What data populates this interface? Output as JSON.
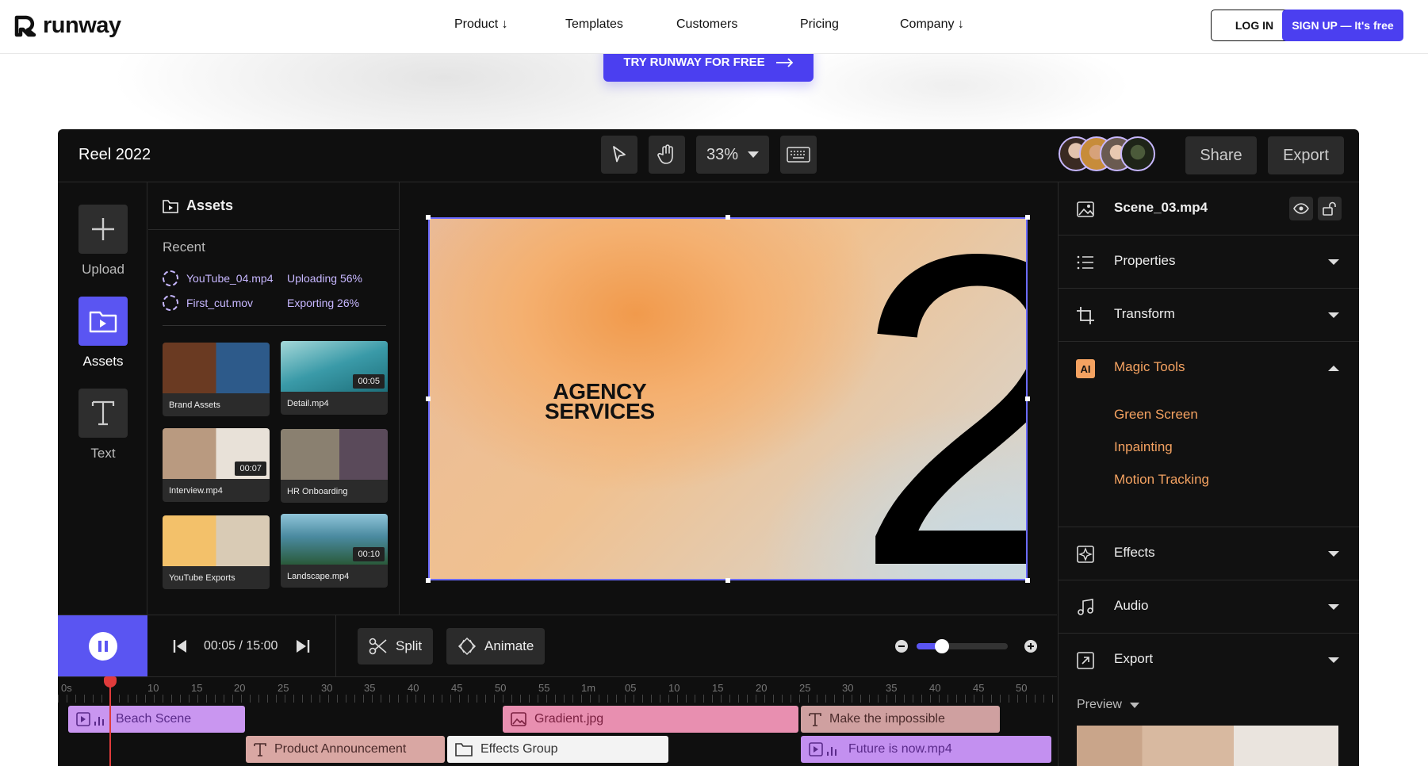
{
  "nav": {
    "brand": "runway",
    "links": [
      "Product ↓",
      "Templates",
      "Customers",
      "Pricing",
      "Company ↓"
    ],
    "login": "LOG IN",
    "signup": "SIGN UP — It's free"
  },
  "cta": {
    "label": "TRY RUNWAY FOR FREE"
  },
  "editor": {
    "project_title": "Reel 2022",
    "zoom": "33%",
    "share": "Share",
    "export": "Export",
    "rail": {
      "upload": "Upload",
      "assets": "Assets",
      "text": "Text"
    },
    "assets_panel": {
      "title": "Assets",
      "recent": "Recent",
      "uploads": [
        {
          "file": "YouTube_04.mp4",
          "status": "Uploading 56%"
        },
        {
          "file": "First_cut.mov",
          "status": "Exporting 26%"
        }
      ],
      "tiles": [
        {
          "name": "Brand Assets",
          "duration": ""
        },
        {
          "name": "Detail.mp4",
          "duration": "00:05"
        },
        {
          "name": "Interview.mp4",
          "duration": "00:07"
        },
        {
          "name": "HR Onboarding",
          "duration": ""
        },
        {
          "name": "YouTube Exports",
          "duration": ""
        },
        {
          "name": "Landscape.mp4",
          "duration": "00:10"
        }
      ]
    },
    "canvas": {
      "headline_line1": "AGENCY",
      "headline_line2": "SERVICES",
      "big_numeral": "2"
    },
    "inspector": {
      "file": "Scene_03.mp4",
      "sections": [
        "Properties",
        "Transform",
        "Magic Tools",
        "Effects",
        "Audio",
        "Export"
      ],
      "magic_tools": [
        "Green Screen",
        "Inpainting",
        "Motion Tracking"
      ],
      "ai_badge": "AI",
      "preview": "Preview"
    },
    "transport": {
      "current": "00:05",
      "total": "15:00",
      "separator": "/",
      "split": "Split",
      "animate": "Animate"
    },
    "ruler_ticks": [
      "0s",
      "10",
      "15",
      "20",
      "25",
      "30",
      "35",
      "40",
      "45",
      "50",
      "55",
      "1m",
      "05",
      "10",
      "15",
      "20",
      "25",
      "30",
      "35",
      "40",
      "45",
      "50"
    ],
    "clips": [
      {
        "label": "Beach Scene",
        "color": "#c996f0"
      },
      {
        "label": "Gradient.jpg",
        "color": "#e88fb0"
      },
      {
        "label": "Make the impossible",
        "color": "#cfa0a0"
      },
      {
        "label": "Product Announcement",
        "color": "#d9a7a3"
      },
      {
        "label": "Effects Group",
        "color": "#f3f3f3"
      },
      {
        "label": "Future is now.mp4",
        "color": "#c390f0"
      }
    ],
    "zoom_slider_level": 0.28
  },
  "colors": {
    "brand": "#4b3ff0",
    "accent_orange": "#f4a261",
    "selection": "#6b6bff",
    "playhead": "#e03b3b"
  }
}
